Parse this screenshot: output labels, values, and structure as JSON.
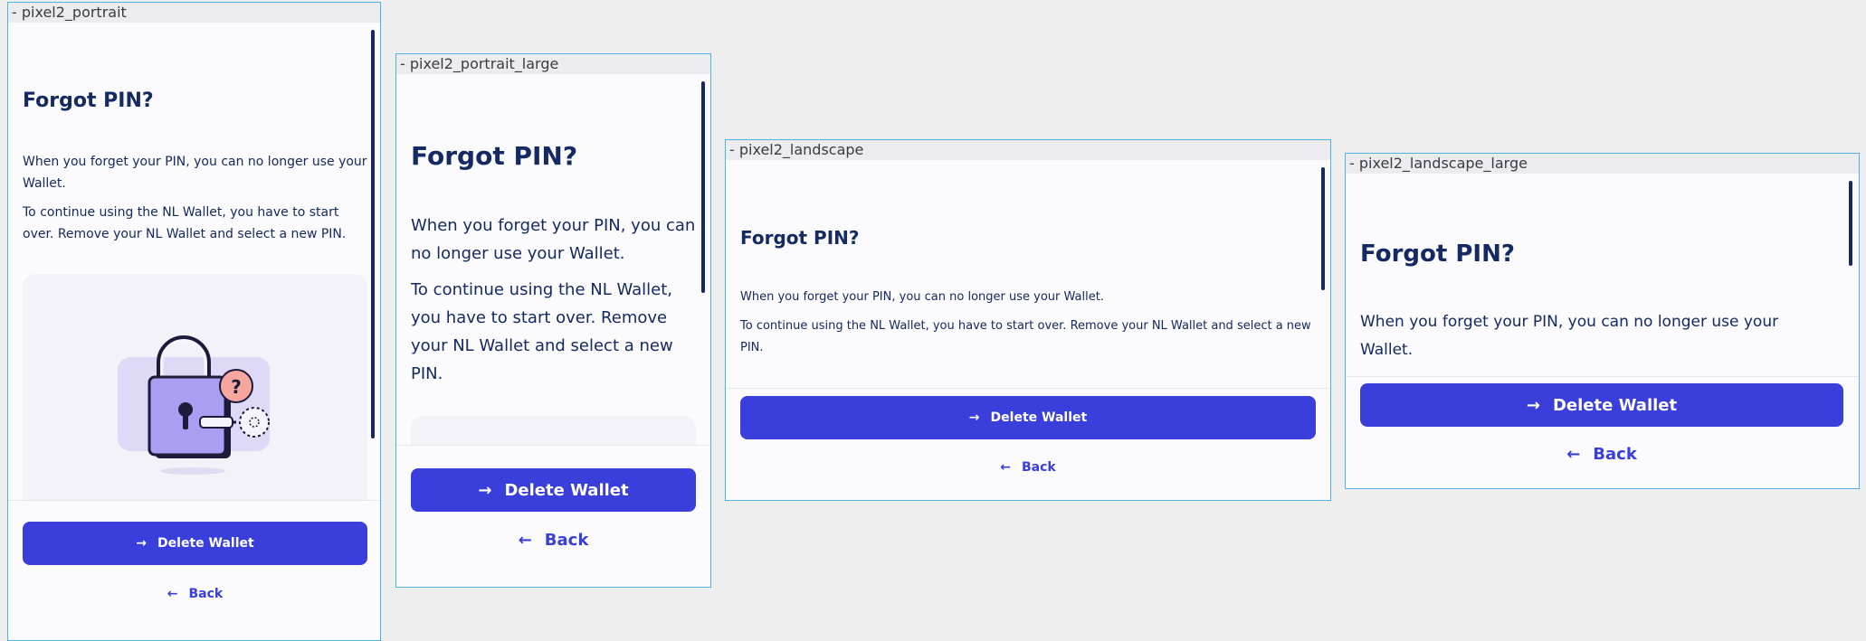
{
  "frames": {
    "portrait": {
      "label": "- pixel2_portrait"
    },
    "portrait_large": {
      "label": "- pixel2_portrait_large"
    },
    "landscape": {
      "label": "- pixel2_landscape"
    },
    "landscape_large": {
      "label": "- pixel2_landscape_large"
    }
  },
  "screen": {
    "title": "Forgot PIN?",
    "paragraph1": "When you forget your PIN, you can no longer use your Wallet.",
    "paragraph2": "To continue using the NL Wallet, you have to start over. Remove your NL Wallet and select a new PIN.",
    "delete_button_label": "Delete Wallet",
    "back_button_label": "Back",
    "arrow_right_icon": "arrow-right-icon",
    "arrow_left_icon": "arrow-left-icon"
  },
  "colors": {
    "primary": "#3a3edb",
    "text": "#152a62",
    "frame_border": "#4db3e6",
    "background": "#fbfbfd"
  },
  "illustration": {
    "icon": "lock-with-key-question-icon"
  }
}
